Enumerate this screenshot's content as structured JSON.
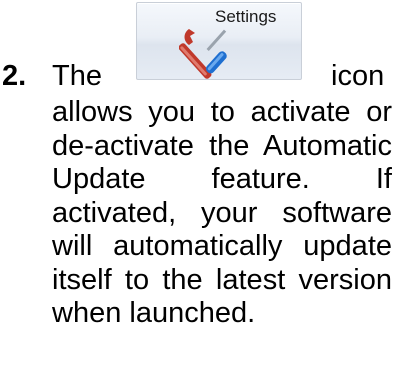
{
  "list_item": {
    "number": "2.",
    "lead_word": "The",
    "button_label": "Settings",
    "button_icon": "settings-tools-icon",
    "trailing_word": "icon",
    "body": "allows you to activate or de-activate the Automatic Update feature. If activated, your software will automatically update itself to the latest version when launched."
  },
  "colors": {
    "text": "#000000",
    "button_border": "#c9cfd8",
    "screwdriver_handle": "#1f6fd0",
    "wrench": "#c0392b"
  }
}
